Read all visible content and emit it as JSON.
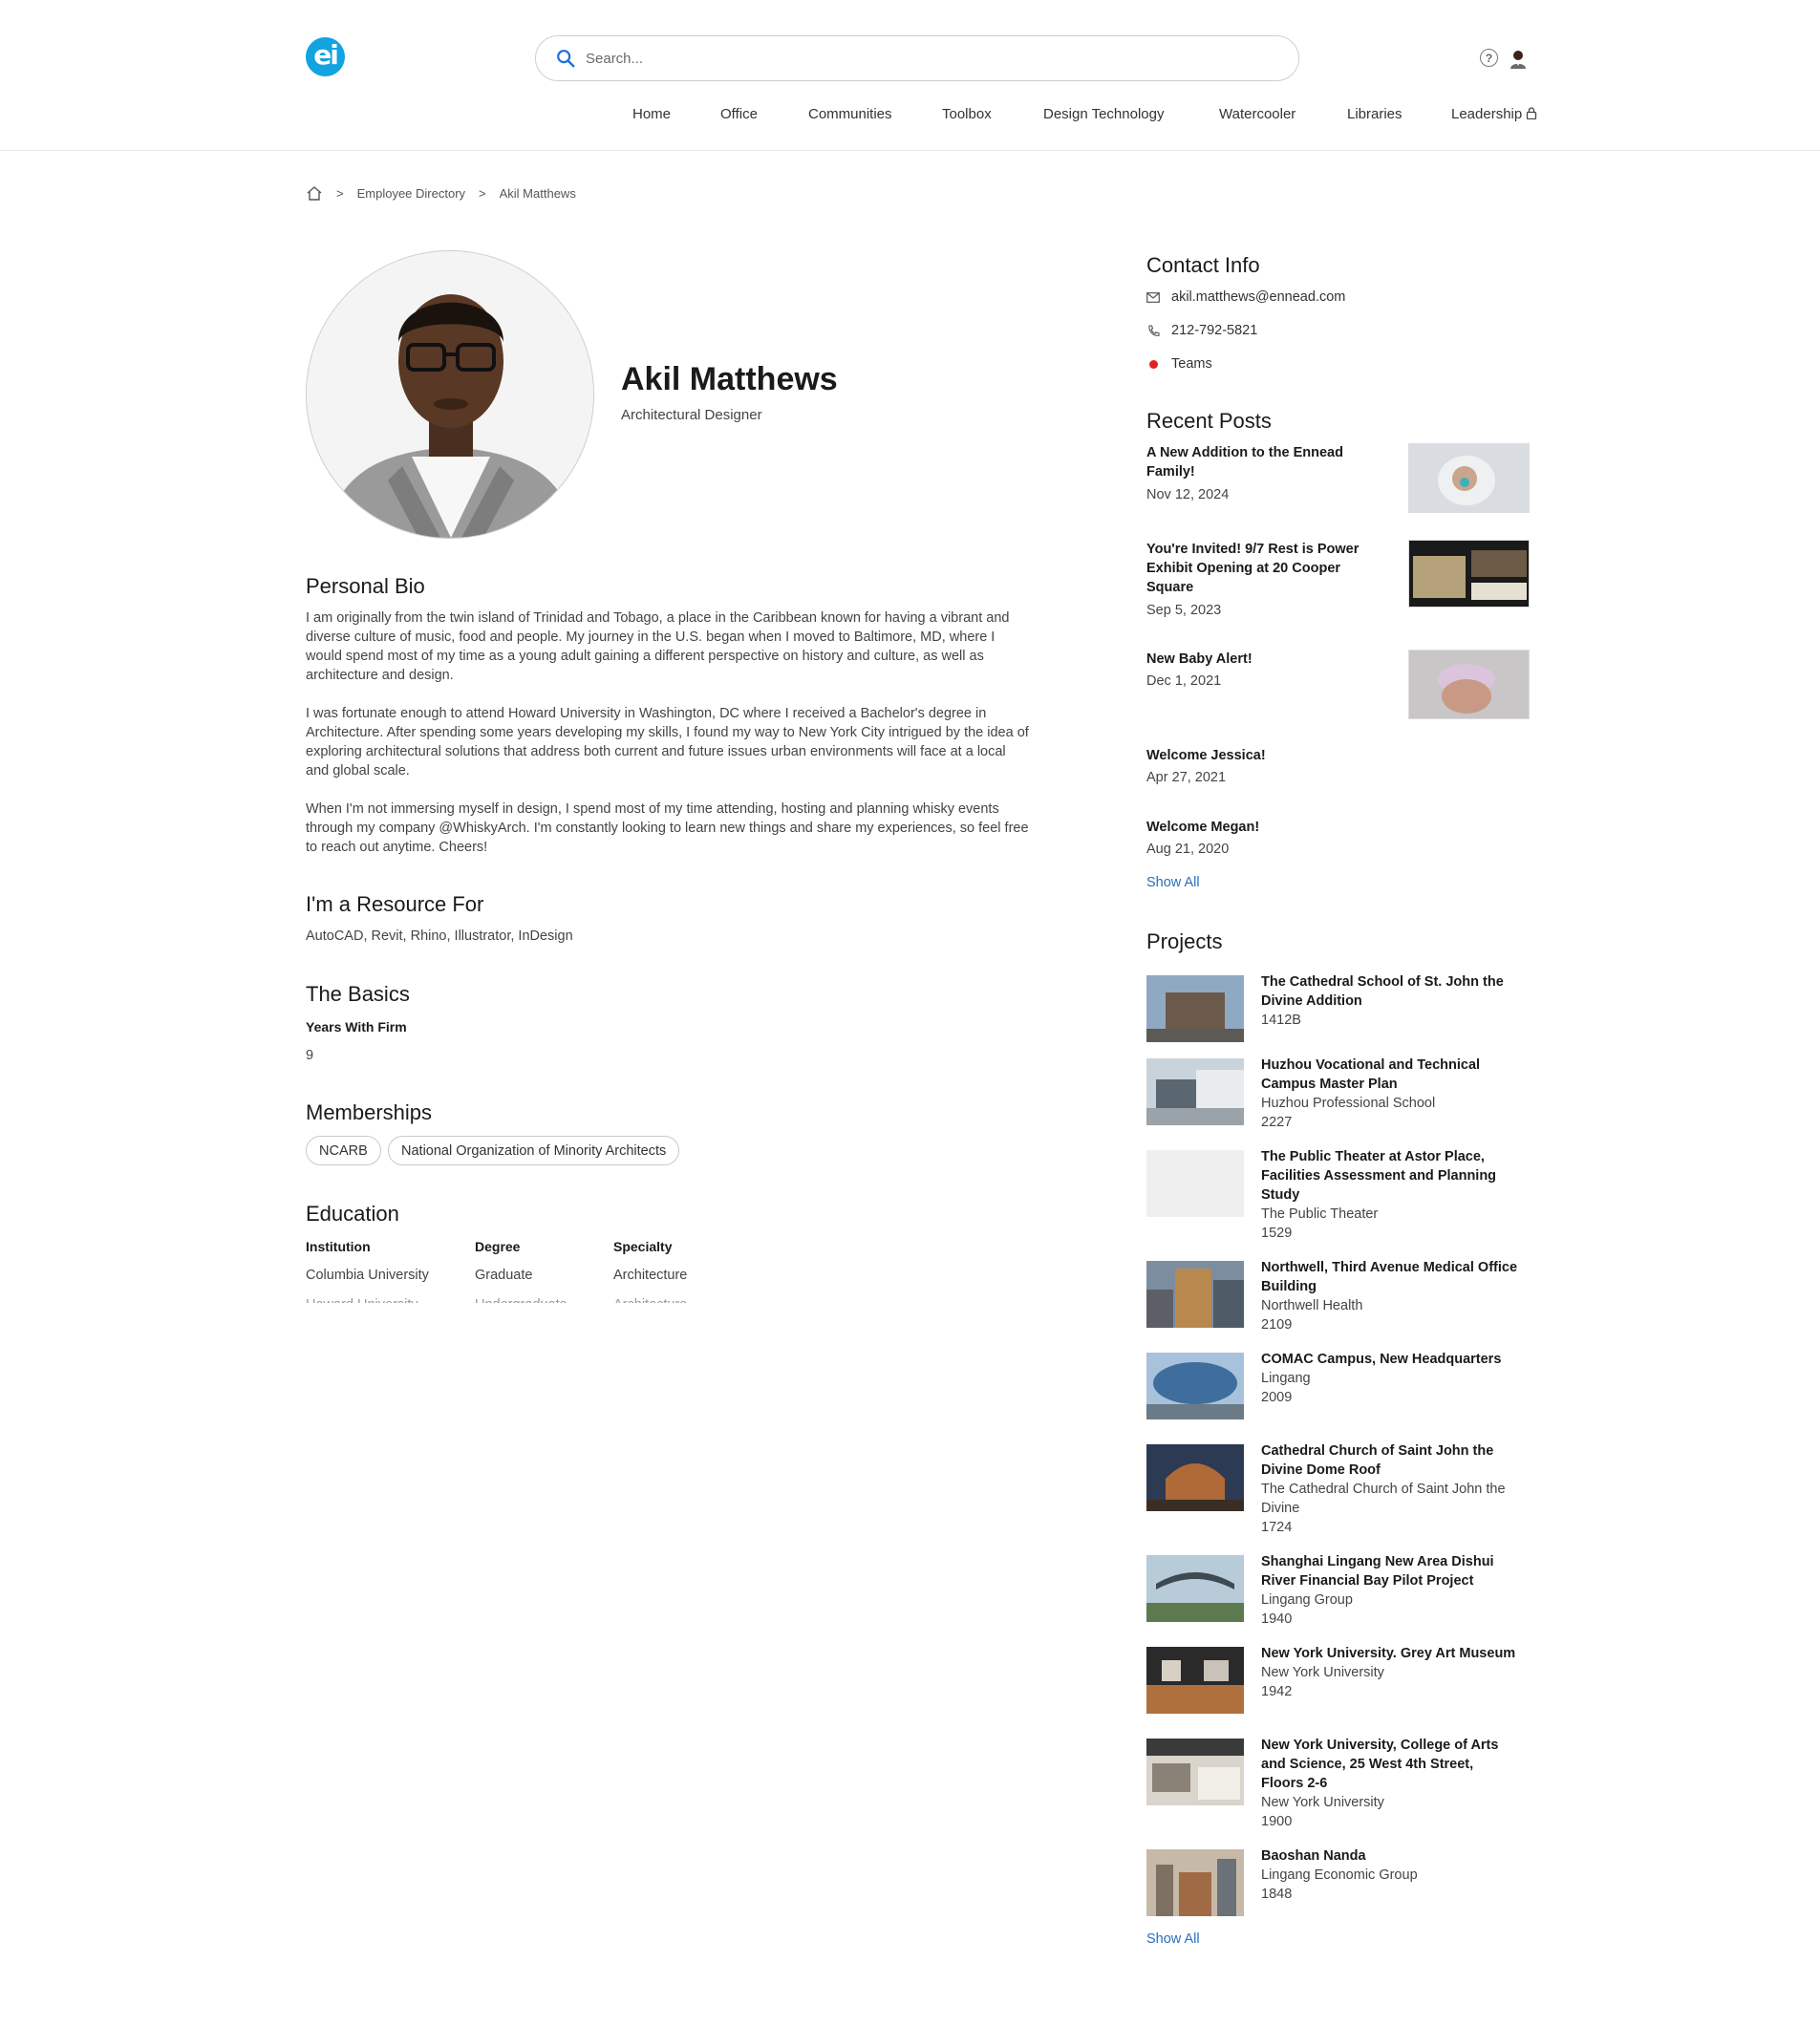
{
  "search": {
    "placeholder": "Search..."
  },
  "nav": [
    "Home",
    "Office",
    "Communities",
    "Toolbox",
    "Design Technology",
    "Watercooler",
    "Libraries",
    "Leadership"
  ],
  "breadcrumb": {
    "items": [
      "Employee Directory",
      "Akil Matthews"
    ],
    "separator": ">"
  },
  "profile": {
    "name": "Akil Matthews",
    "title": "Architectural Designer"
  },
  "bio": {
    "heading": "Personal Bio",
    "paragraphs": [
      "I am originally from the twin island of Trinidad and Tobago, a place in the Caribbean known for having a vibrant and diverse culture of music, food and people. My journey in the U.S. began when I moved to Baltimore, MD, where I would spend most of my time as a young adult gaining a different perspective on history and culture, as well as architecture and design.",
      "I was fortunate enough to attend Howard University in Washington, DC where I received a Bachelor's degree in Architecture. After spending some years developing my skills, I found my way to New York City intrigued by the idea of exploring architectural solutions that address both current and future issues urban environments will face at a local and global scale.",
      "When I'm not immersing myself in design, I spend most of my time attending, hosting and planning whisky events through my company @WhiskyArch. I'm constantly looking to learn new things and share my experiences, so feel free to reach out anytime. Cheers!"
    ]
  },
  "resource": {
    "heading": "I'm a Resource For",
    "text": "AutoCAD, Revit, Rhino, Illustrator, InDesign"
  },
  "basics": {
    "heading": "The Basics",
    "label": "Years With Firm",
    "value": "9"
  },
  "memberships": {
    "heading": "Memberships",
    "items": [
      "NCARB",
      "National Organization of Minority Architects"
    ]
  },
  "education": {
    "heading": "Education",
    "columns": [
      "Institution",
      "Degree",
      "Specialty"
    ],
    "rows": [
      [
        "Columbia University",
        "Graduate",
        "Architecture"
      ],
      [
        "Howard University",
        "Undergraduate",
        "Architecture"
      ]
    ]
  },
  "contact": {
    "heading": "Contact Info",
    "email": "akil.matthews@ennead.com",
    "phone": "212-792-5821",
    "teams": "Teams",
    "teams_color": "#e0221e"
  },
  "recent_posts": {
    "heading": "Recent Posts",
    "items": [
      {
        "title": "A New Addition to the Ennead Family!",
        "date": "Nov 12, 2024"
      },
      {
        "title": "You're Invited! 9/7 Rest is Power Exhibit Opening at 20 Cooper Square",
        "date": "Sep 5, 2023"
      },
      {
        "title": "New Baby Alert!",
        "date": "Dec 1, 2021"
      },
      {
        "title": "Welcome Jessica!",
        "date": "Apr 27, 2021"
      },
      {
        "title": "Welcome Megan!",
        "date": "Aug 21, 2020"
      }
    ],
    "show_all": "Show All"
  },
  "projects": {
    "heading": "Projects",
    "items": [
      {
        "title": "The Cathedral School of St. John the Divine Addition",
        "client": "",
        "number": "1412B"
      },
      {
        "title": "Huzhou Vocational and Technical Campus Master Plan",
        "client": "Huzhou Professional School",
        "number": "2227"
      },
      {
        "title": "The Public Theater at Astor Place, Facilities Assessment and Planning Study",
        "client": "The Public Theater",
        "number": "1529"
      },
      {
        "title": "Northwell, Third Avenue Medical Office Building",
        "client": "Northwell Health",
        "number": "2109"
      },
      {
        "title": "COMAC Campus, New Headquarters",
        "client": "Lingang",
        "number": "2009"
      },
      {
        "title": "Cathedral Church of Saint John the Divine Dome Roof",
        "client": "The Cathedral Church of Saint John the Divine",
        "number": "1724"
      },
      {
        "title": "Shanghai Lingang New Area Dishui River Financial Bay Pilot Project",
        "client": "Lingang Group",
        "number": "1940"
      },
      {
        "title": "New York University. Grey Art Museum",
        "client": "New York University",
        "number": "1942"
      },
      {
        "title": "New York University, College of Arts and Science, 25 West 4th Street, Floors 2-6",
        "client": "New York University",
        "number": "1900"
      },
      {
        "title": "Baoshan Nanda",
        "client": "Lingang Economic Group",
        "number": "1848"
      }
    ],
    "show_all": "Show All"
  },
  "colors": {
    "brand": "#12a3e1",
    "link": "#2a6ebb",
    "search_icon": "#1e6fd9"
  },
  "icons": [
    "search-icon",
    "help-icon",
    "user-avatar-icon",
    "lock-icon",
    "home-icon",
    "mail-icon",
    "phone-icon",
    "status-dot-icon"
  ]
}
